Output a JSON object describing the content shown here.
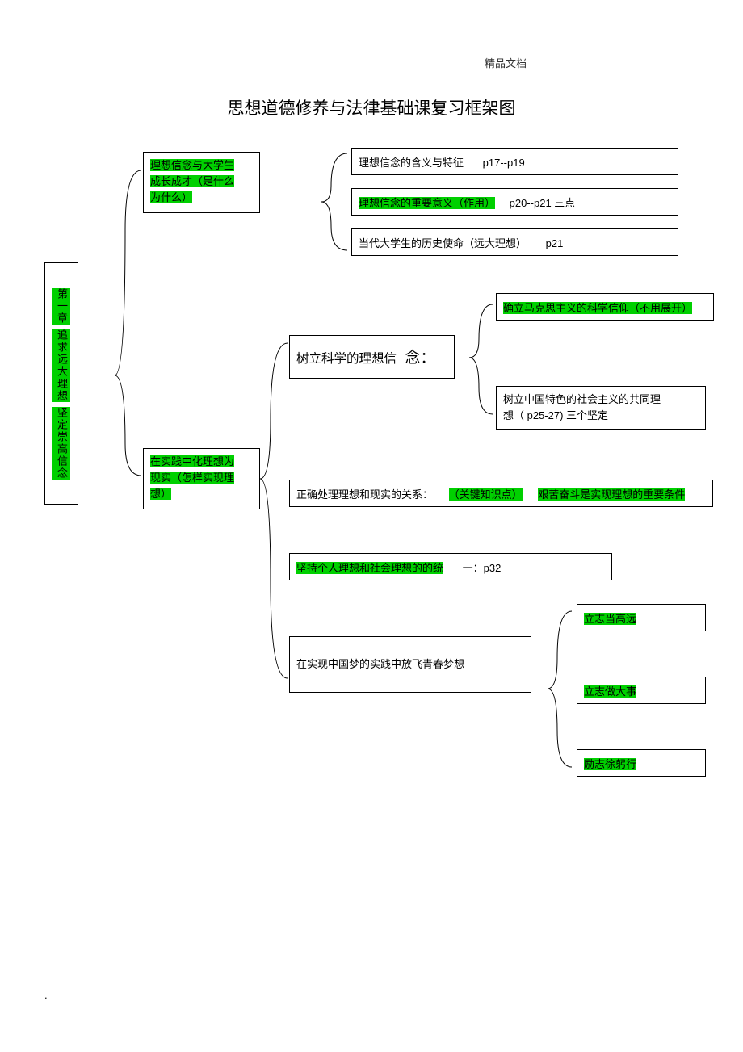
{
  "header_right": "精品文档",
  "title": "思想道德修养与法律基础课复习框架图",
  "chapter_box": {
    "line1": "第一章",
    "line2": "追求远大理想",
    "line3": "坚定崇高信念"
  },
  "section1": {
    "hl1": "理想信念与大学生",
    "hl2": "成长成才（是什么",
    "hl3": "为什么）"
  },
  "s1_r1_a": "理想信念的含义与特征",
  "s1_r1_b": "p17--p19",
  "s1_r2_hl": "理想信念的重要意义（作用）",
  "s1_r2_tail": "p20--p21 三点",
  "s1_r3_a": "当代大学生的历史使命（远大理想）",
  "s1_r3_b": "p21",
  "section2": {
    "hl1": "在实践中化理想为",
    "hl2": "现实（怎样实现理",
    "hl3": "想）"
  },
  "s2_b1_a": "树立科学的理想信",
  "s2_b1_b": "念：",
  "s2_b1_r1": "确立马克思主义的科学信仰（不用展开）",
  "s2_b1_r2_a": "树立中国特色的社会主义的共同理",
  "s2_b1_r2_b": "想（ p25-27) 三个坚定",
  "s2_b2_a": "正确处理理想和现实的关系：",
  "s2_b2_hl1": "（关键知识点）",
  "s2_b2_hl2": "艰苦奋斗是实现理想的重要条件",
  "s2_b3_hl": "坚持个人理想和社会理想的的统",
  "s2_b3_tail": "一：p32",
  "s2_b4": "在实现中国梦的实践中放飞青春梦想",
  "s2_b4_r1": "立志当高远",
  "s2_b4_r2": "立志做大事",
  "s2_b4_r3": "励志徐躬行",
  "footer_dot": "."
}
